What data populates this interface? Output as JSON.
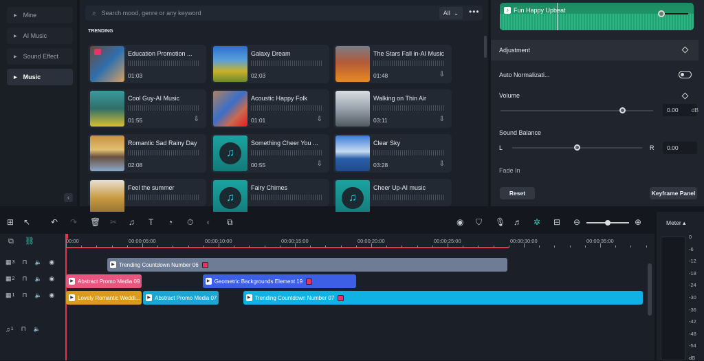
{
  "sidebar": {
    "items": [
      {
        "label": "Mine"
      },
      {
        "label": "AI Music"
      },
      {
        "label": "Sound Effect"
      },
      {
        "label": "Music",
        "active": true
      }
    ]
  },
  "library": {
    "search_placeholder": "Search mood, genre or any keyword",
    "filter": "All",
    "more": "•••",
    "section": "TRENDING",
    "tracks": [
      {
        "title": "Education Promotion ...",
        "duration": "01:03",
        "thumb": "linear-gradient(135deg,#6a4a3a,#2e6fae 50%,#d8a062)",
        "premium": true,
        "download": false
      },
      {
        "title": "Galaxy Dream",
        "duration": "02:03",
        "thumb": "linear-gradient(180deg,#2c6fd0,#5aa0d8 40%,#c9b12a 70%,#6d8a2a)",
        "download": false
      },
      {
        "title": "The Stars Fall in-AI Music",
        "duration": "01:48",
        "thumb": "linear-gradient(180deg,#7a7d86,#b25a3a 45%,#e88a20)",
        "download": true
      },
      {
        "title": "Cool Guy-AI Music",
        "duration": "01:55",
        "thumb": "linear-gradient(180deg,#3a9a9a,#2f6f6a 50%,#d8c030)",
        "download": true
      },
      {
        "title": "Acoustic Happy Folk",
        "duration": "01:01",
        "thumb": "linear-gradient(135deg,#b08060,#3a6fc8 45%,#c86a50 70%,#e81e1e)",
        "download": true
      },
      {
        "title": "Walking on Thin Air",
        "duration": "03:11",
        "thumb": "linear-gradient(180deg,#d9dde2,#9aa3ad 50%,#505860)",
        "download": true
      },
      {
        "title": "Romantic Sad Rainy Day",
        "duration": "02:08",
        "thumb": "linear-gradient(180deg,#c89040,#e0c070 40%,#6a5040 60%,#8aa8c8)",
        "download": false
      },
      {
        "title": "Something Cheer You ...",
        "duration": "00:55",
        "thumb": "music",
        "download": true
      },
      {
        "title": "Clear Sky",
        "duration": "03:28",
        "thumb": "linear-gradient(180deg,#3a7ad8,#c8dcf0 45%,#2a5fa8 65%,#1f4a8a)",
        "download": true
      },
      {
        "title": "Feel the summer",
        "duration": "",
        "thumb": "linear-gradient(180deg,#e8e0d0,#c89a40 50%,#8a6a30)",
        "download": false
      },
      {
        "title": "Fairy Chimes",
        "duration": "",
        "thumb": "music",
        "download": false
      },
      {
        "title": "Cheer Up-AI music",
        "duration": "",
        "thumb": "music",
        "download": false
      }
    ]
  },
  "properties": {
    "audio_clip": "Fun Happy Upbeat",
    "adjustment": "Adjustment",
    "auto_normalization": "Auto Normalizati...",
    "auto_normalization_on": false,
    "volume_label": "Volume",
    "volume_value": "0.00",
    "volume_unit": "dB",
    "volume_level": 0.8,
    "balance_label": "Sound Balance",
    "balance_left": "L",
    "balance_right": "R",
    "balance_value": "0.00",
    "balance_level": 0.5,
    "fade_in": "Fade In",
    "reset": "Reset",
    "keyframe_panel": "Keyframe Panel"
  },
  "toolbar": {
    "left_icons": [
      "multi-select-icon",
      "pointer-icon",
      "undo-icon",
      "redo-icon",
      "delete-icon",
      "cut-icon",
      "audio-icon",
      "text-icon",
      "speed-icon",
      "timer-icon",
      "color-icon",
      "crop-icon"
    ],
    "right_icons": [
      "render-icon",
      "marker-icon",
      "mic-icon",
      "music-note-icon",
      "ai-icon",
      "fit-icon"
    ],
    "zoom_level": 0.5,
    "meter_label": "Meter ▴"
  },
  "timeline": {
    "ruler": [
      "00:00",
      "00:00:05:00",
      "00:00:10:00",
      "00:00:15:00",
      "00:00:20:00",
      "00:00:25:00",
      "00:00:30:00",
      "00:00:35:00"
    ],
    "tracks": [
      {
        "label": "3",
        "type": "video"
      },
      {
        "label": "2",
        "type": "video"
      },
      {
        "label": "1",
        "type": "video"
      },
      {
        "label": "1",
        "type": "audio"
      }
    ],
    "clips": [
      {
        "name": "Trending Countdown Number 06",
        "track": 3,
        "color": "#6e7d95",
        "premium": true
      },
      {
        "name": "Abstract Promo Media 09",
        "track": 2,
        "color": "#e8557f",
        "premium": false
      },
      {
        "name": "Geometric Backgrounds Element 19",
        "track": 2,
        "color": "#3d5fe6",
        "premium": true
      },
      {
        "name": "Lovely Romantic Weddi...",
        "track": 1,
        "color": "#d99a1e",
        "premium": false
      },
      {
        "name": "Abstract Promo Media 07",
        "track": 1,
        "color": "#1aa5d2",
        "premium": false
      },
      {
        "name": "Trending Countdown Number 07",
        "track": 1,
        "color": "#10b2e3",
        "premium": true
      }
    ]
  },
  "meter": {
    "scale": [
      "0",
      "-6",
      "-12",
      "-18",
      "-24",
      "-30",
      "-36",
      "-42",
      "-48",
      "-54",
      "dB"
    ]
  },
  "colors": {
    "accent": "#e2364f",
    "audio_wave": "#21a374"
  }
}
